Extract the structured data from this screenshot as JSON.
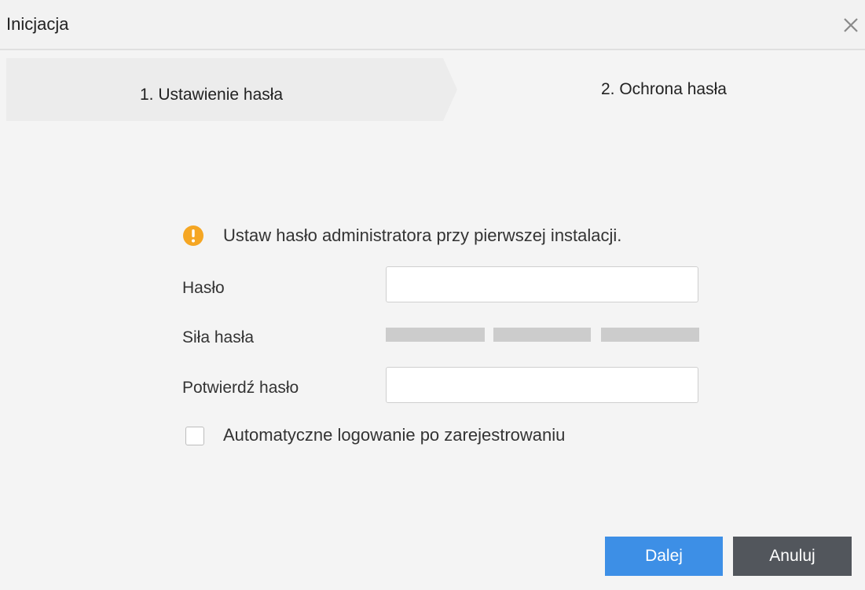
{
  "dialog": {
    "title": "Inicjacja",
    "close_icon": "close-icon"
  },
  "steps": [
    {
      "label": "1. Ustawienie hasła"
    },
    {
      "label": "2. Ochrona hasła"
    }
  ],
  "form": {
    "warning_icon": "warning-icon",
    "warning_text": "Ustaw hasło administratora przy pierwszej instalacji.",
    "password_label": "Hasło",
    "password_value": "",
    "strength_label": "Siła hasła",
    "strength_levels_filled": 0,
    "strength_levels_total": 3,
    "confirm_label": "Potwierdź hasło",
    "confirm_value": "",
    "auto_login_label": "Automatyczne logowanie po zarejestrowaniu",
    "auto_login_checked": false
  },
  "buttons": {
    "next_label": "Dalej",
    "cancel_label": "Anuluj"
  },
  "colors": {
    "accent": "#3d8fe6",
    "cancel": "#52565c",
    "warning": "#f5a623",
    "strength_empty": "#cccccc"
  }
}
